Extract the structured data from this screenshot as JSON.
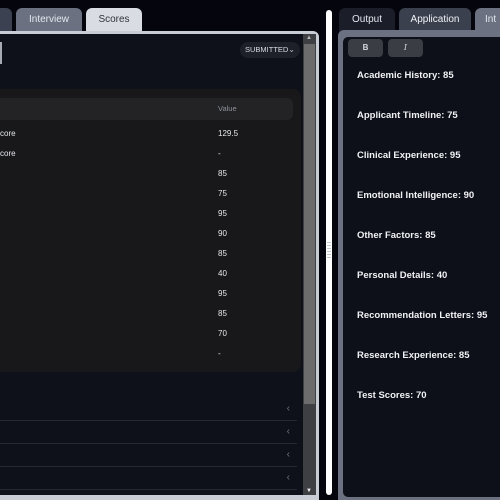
{
  "left_panel": {
    "tabs": [
      {
        "label": ""
      },
      {
        "label": "Interview"
      },
      {
        "label": "Scores",
        "active": true
      }
    ],
    "status": {
      "label": "SUBMITTED",
      "icon": "chevron-down-icon"
    },
    "table": {
      "columns": [
        "",
        "Value"
      ],
      "rows": [
        {
          "name": "core",
          "value": "129.5"
        },
        {
          "name": "core",
          "value": "-"
        },
        {
          "name": "",
          "value": "85"
        },
        {
          "name": "",
          "value": "75"
        },
        {
          "name": "",
          "value": "95"
        },
        {
          "name": "",
          "value": "90"
        },
        {
          "name": "",
          "value": "85"
        },
        {
          "name": "",
          "value": "40"
        },
        {
          "name": "",
          "value": "95"
        },
        {
          "name": "",
          "value": "85"
        },
        {
          "name": "",
          "value": "70"
        },
        {
          "name": "",
          "value": "-"
        }
      ]
    },
    "accordion_count": 4,
    "chevron_icon": "chevron-left-icon"
  },
  "right_panel": {
    "tabs": [
      {
        "label": "Output"
      },
      {
        "label": "Application",
        "active": true
      },
      {
        "label": "Int"
      }
    ],
    "toolbar": {
      "bold_label": "B",
      "italic_label": "I"
    },
    "scores": [
      "Academic History: 85",
      "Applicant Timeline: 75",
      "Clinical Experience: 95",
      "Emotional Intelligence: 90",
      "Other Factors: 85",
      "Personal Details: 40",
      "Recommendation Letters: 95",
      "Research Experience: 85",
      "Test Scores: 70"
    ]
  },
  "colors": {
    "background": "#05060d",
    "panel": "#0f111a",
    "table_card": "#18181b",
    "active_tab": "#d9dce3",
    "text": "#e6e8ec"
  }
}
